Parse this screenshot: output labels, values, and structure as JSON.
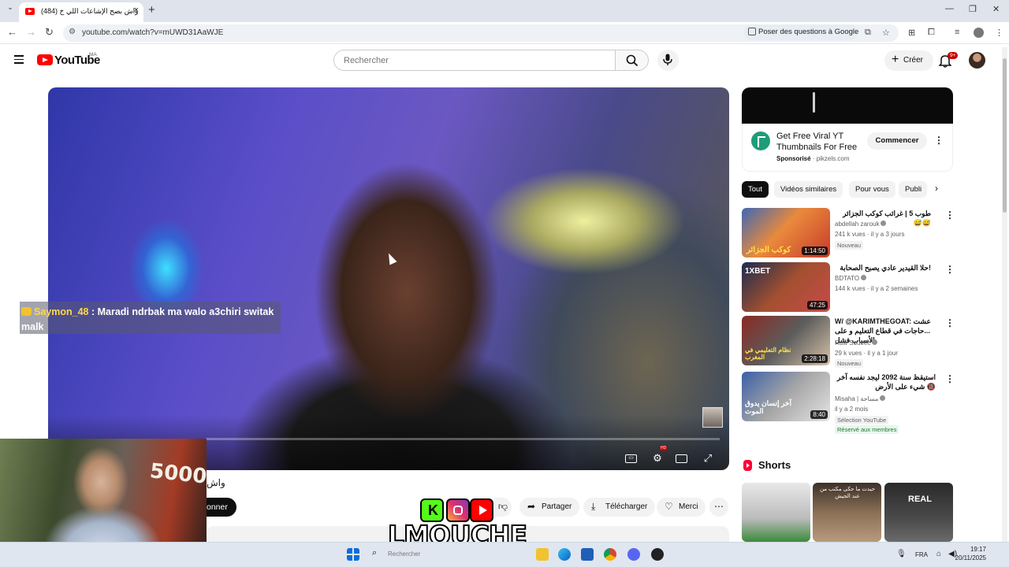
{
  "browser": {
    "tab_title": "(484) واش بصح الإشاعات اللي خ",
    "url": "youtube.com/watch?v=mUWD31AaWJE",
    "ask_google": "Poser des questions à Google"
  },
  "header": {
    "logo_text": "YouTube",
    "region": "MA",
    "search_placeholder": "Rechercher",
    "create_label": "Créer",
    "notifications_badge": "9+"
  },
  "player": {
    "chat_user": "Saymon_48",
    "chat_text": " : Maradi ndrbak ma walo a3chiri switak malk"
  },
  "video": {
    "title": "واش",
    "subscribe_label": "onner",
    "share_label": "Partager",
    "download_label": "Télécharger",
    "thanks_label": "Merci"
  },
  "ad": {
    "title": "Get Free Viral YT Thumbnails For Free",
    "sponsored": "Sponsorisé",
    "domain": "pikzels.com",
    "cta": "Commencer"
  },
  "chips": [
    "Tout",
    "Vidéos similaires",
    "Pour vous",
    "Publi"
  ],
  "related": [
    {
      "title": "طوب 5 | غرائب كوكب الجزائر 😅😅",
      "channel": "abdellah zarouk",
      "meta": "241 k vues · il y a 3 jours",
      "badge": "Nouveau",
      "duration": "1:14:50",
      "thumb_text": "كوكب الجزائر"
    },
    {
      "title": "حلا القيدير عادي يصبح الصحابة!",
      "channel": "BDTATO",
      "meta": "144 k vues · il y a 2 semaines",
      "badge": "",
      "duration": "47:25",
      "thumb_text": "1XBET"
    },
    {
      "title": "W/ @KARIMTHEGOAT: عشت ...حاجات في قطاع التعليم و على الأسباب فشل",
      "channel": "Raw Soueëc",
      "meta": "29 k vues · il y a 1 jour",
      "badge": "Nouveau",
      "duration": "2:28:18",
      "thumb_text": "نظام التعليمي في المغرب"
    },
    {
      "title": "استيقظ سنة 2092 ليجد نفسه آخر شيء على الأرض 🔞",
      "channel": "Misaha | مساحة",
      "meta": "il y a 2 mois",
      "badge": "Sélection YouTube",
      "members": "Réservé aux membres",
      "duration": "8:40",
      "thumb_text": "آخر إنسان يدوق الموت"
    }
  ],
  "shorts": {
    "title": "Shorts",
    "items": [
      {
        "text": ""
      },
      {
        "text": "حيدت ما حكى مكتب من عند الجيش"
      },
      {
        "text": "REAL"
      }
    ]
  },
  "overlay": {
    "webcam_text": "5000",
    "brand_text": "LMOUCHE"
  },
  "taskbar": {
    "search_placeholder": "Rechercher",
    "lang": "FRA",
    "time": "19:17",
    "date": "20/11/2025"
  }
}
